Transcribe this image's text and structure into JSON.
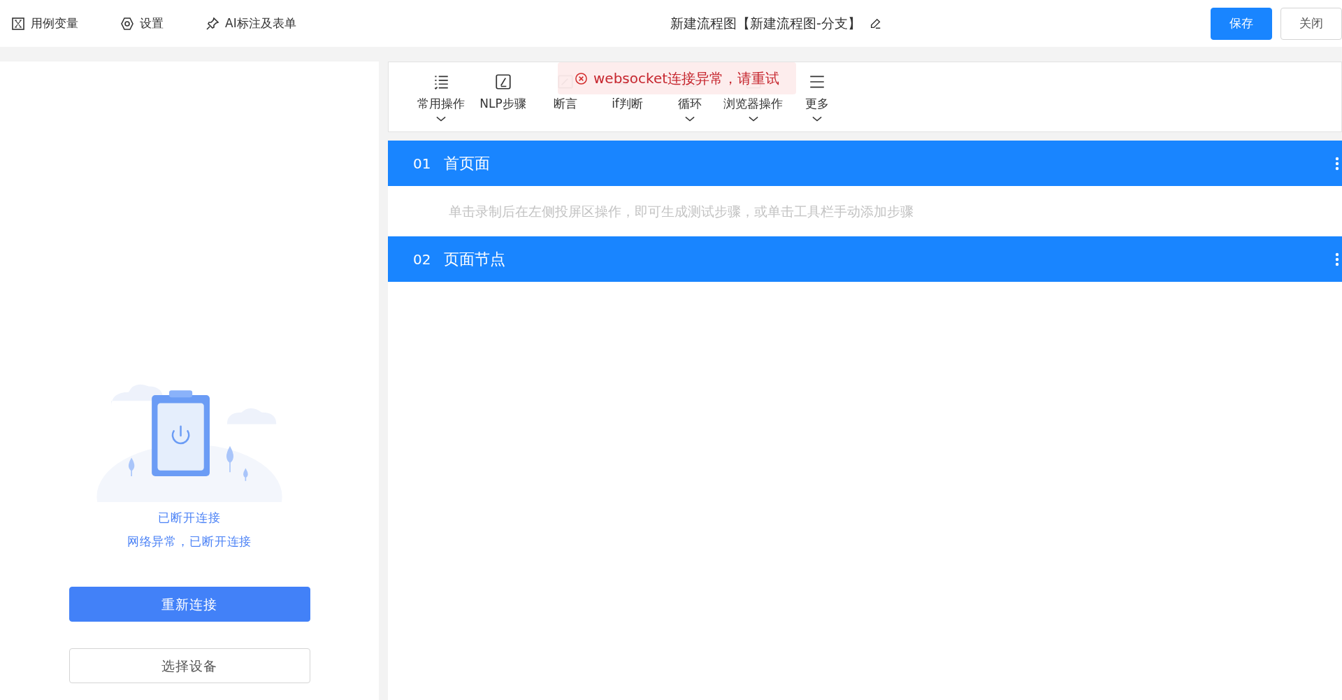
{
  "header": {
    "tools": [
      {
        "label": "用例变量"
      },
      {
        "label": "设置"
      },
      {
        "label": "AI标注及表单"
      }
    ],
    "title": "新建流程图【新建流程图-分支】",
    "buttons": [
      {
        "label": "保存",
        "kind": "primary"
      },
      {
        "label": "关闭",
        "kind": "default"
      }
    ]
  },
  "device_panel": {
    "status": "已断开连接",
    "message": "网络异常，已断开连接",
    "buttons": [
      {
        "label": "重新连接",
        "kind": "primary"
      },
      {
        "label": "选择设备",
        "kind": "default"
      }
    ]
  },
  "toolbar": {
    "items": [
      {
        "label": "常用操作",
        "dropdown": true
      },
      {
        "label": "NLP步骤",
        "dropdown": false
      },
      {
        "label": "断言",
        "dropdown": false
      },
      {
        "label": "if判断",
        "dropdown": false
      },
      {
        "label": "循环",
        "dropdown": true
      },
      {
        "label": "浏览器操作",
        "dropdown": true
      },
      {
        "label": "更多",
        "dropdown": true
      }
    ]
  },
  "toast": {
    "message": "websocket连接异常，请重试"
  },
  "pages": [
    {
      "number": "01",
      "title": "首页面",
      "hint": "单击录制后在左侧投屏区操作，即可生成测试步骤，或单击工具栏手动添加步骤"
    },
    {
      "number": "02",
      "title": "页面节点"
    }
  ]
}
